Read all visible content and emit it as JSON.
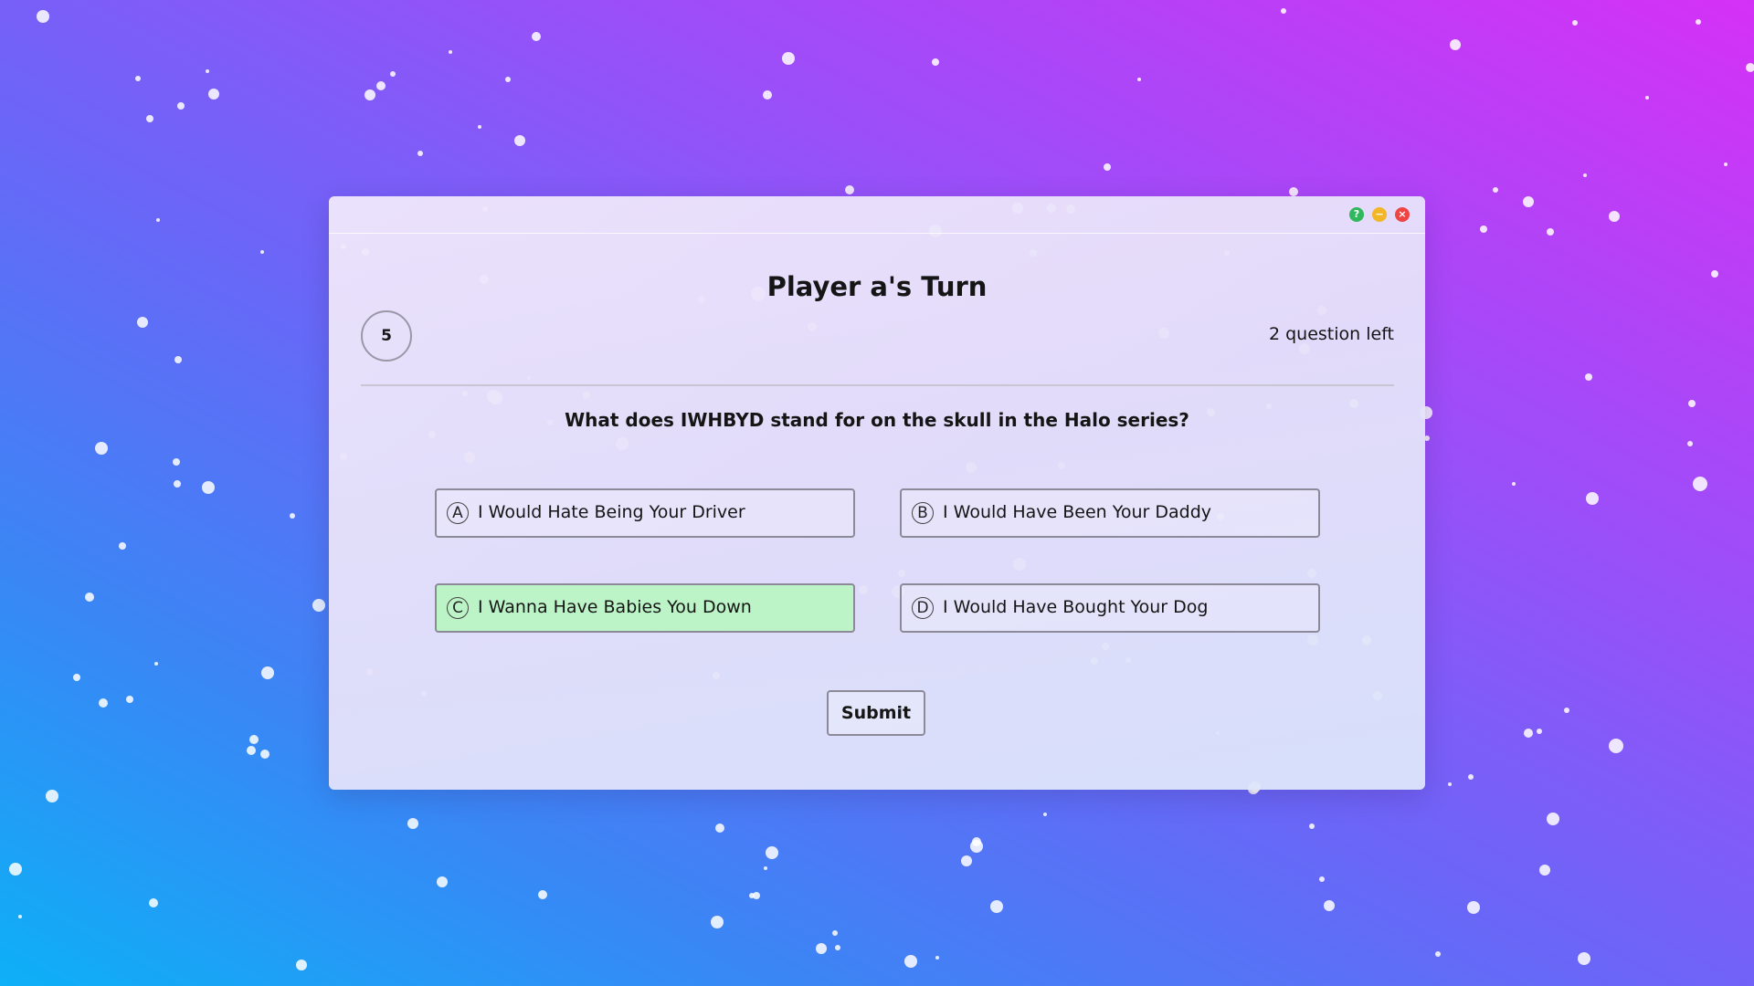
{
  "window": {
    "help_icon": "?",
    "minimize_icon": "−",
    "close_icon": "×"
  },
  "game": {
    "title": "Player a's Turn",
    "timer": "5",
    "questions_left": "2 question left",
    "question": "What does IWHBYD stand for on the skull in the Halo series?",
    "options": [
      {
        "letter": "A",
        "text": "I Would Hate Being Your Driver",
        "selected": false
      },
      {
        "letter": "B",
        "text": "I Would Have Been Your Daddy",
        "selected": false
      },
      {
        "letter": "C",
        "text": "I Wanna Have Babies You Down",
        "selected": true
      },
      {
        "letter": "D",
        "text": "I Would Have Bought Your Dog",
        "selected": false
      }
    ],
    "submit_label": "Submit"
  },
  "colors": {
    "selected_option": "#bcf4c7",
    "help_button": "#2fb85c",
    "minimize_button": "#f2b626",
    "close_button": "#ee4444"
  }
}
